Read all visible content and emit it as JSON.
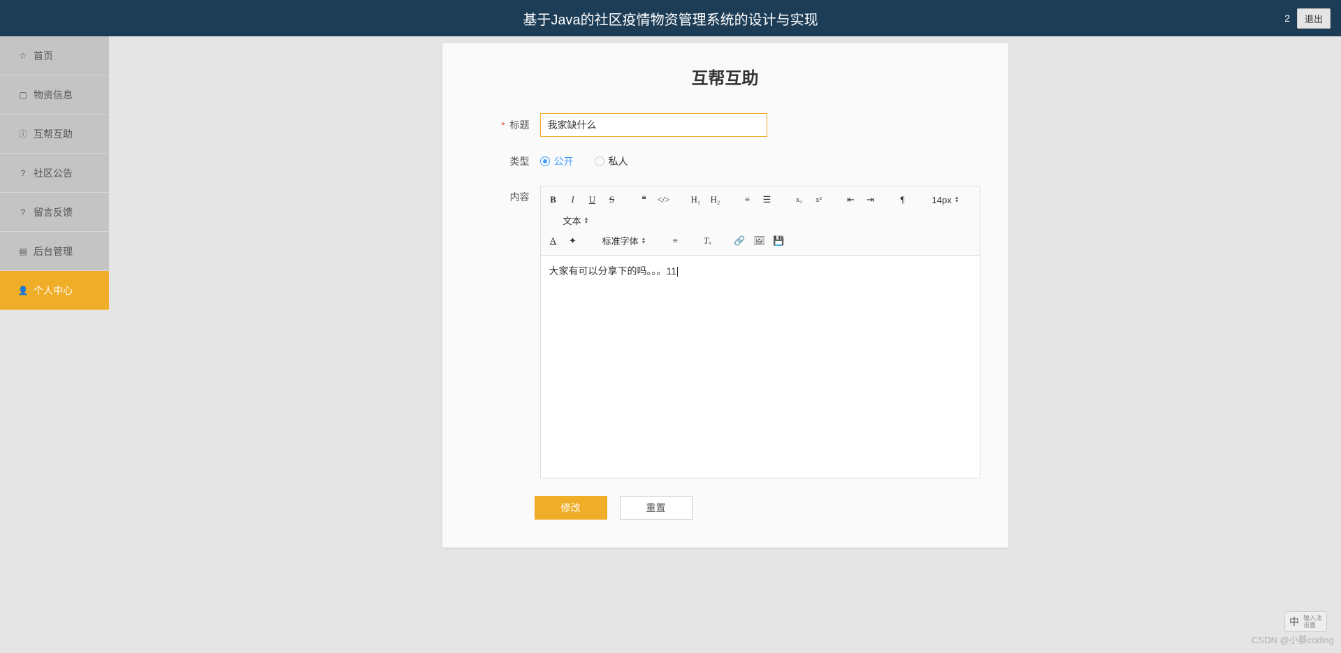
{
  "header": {
    "title": "基于Java的社区疫情物资管理系统的设计与实现",
    "user": "2",
    "logout": "退出"
  },
  "sidebar": {
    "items": [
      {
        "label": "首页",
        "icon": "star"
      },
      {
        "label": "物资信息",
        "icon": "package"
      },
      {
        "label": "互帮互助",
        "icon": "info"
      },
      {
        "label": "社区公告",
        "icon": "help"
      },
      {
        "label": "留言反馈",
        "icon": "help"
      },
      {
        "label": "后台管理",
        "icon": "file"
      },
      {
        "label": "个人中心",
        "icon": "user"
      }
    ]
  },
  "form": {
    "title": "互帮互助",
    "fields": {
      "title_label": "标题",
      "title_value": "我家缺什么",
      "type_label": "类型",
      "type_public": "公开",
      "type_private": "私人",
      "content_label": "内容",
      "content_value": "大家有可以分享下的吗。。。11"
    },
    "toolbar": {
      "font_size": "14px",
      "text_format": "文本",
      "font_family": "标准字体"
    },
    "buttons": {
      "submit": "修改",
      "reset": "重置"
    }
  },
  "watermark": "CSDN @小蔡coding",
  "ime": {
    "lang": "中"
  }
}
